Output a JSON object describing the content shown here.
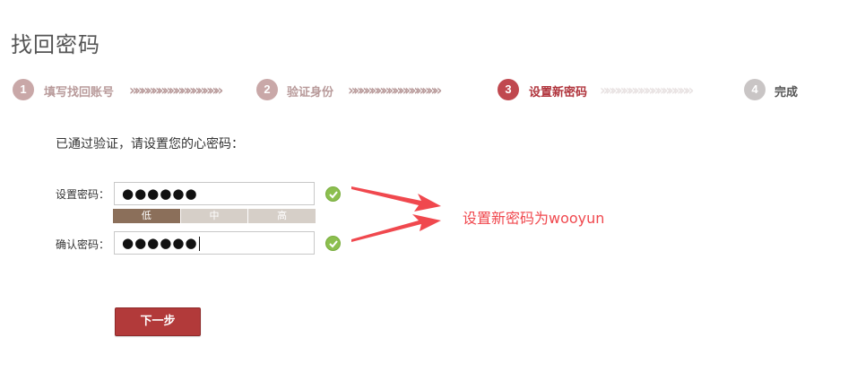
{
  "page_title": "找回密码",
  "steps": [
    {
      "num": "1",
      "label": "填写找回账号",
      "state": "done"
    },
    {
      "num": "2",
      "label": "验证身份",
      "state": "done"
    },
    {
      "num": "3",
      "label": "设置新密码",
      "state": "active"
    },
    {
      "num": "4",
      "label": "完成",
      "state": "todo"
    }
  ],
  "step_arrows": "»»»»»»»»»»»»»»»»",
  "prompt": "已通过验证，请设置您的心密码：",
  "form": {
    "password_label": "设置密码：",
    "password_value": "●●●●●●",
    "confirm_label": "确认密码：",
    "confirm_value": "●●●●●●",
    "strength": {
      "levels": [
        "低",
        "中",
        "高"
      ],
      "current": "低"
    }
  },
  "next_button": "下一步",
  "annotation": "设置新密码为wooyun",
  "colors": {
    "active_step": "#c0484f",
    "done_step": "#c9a8a8",
    "button": "#b23a3a",
    "annotation": "#f0484e",
    "ok_icon": "#8cbf4f"
  }
}
